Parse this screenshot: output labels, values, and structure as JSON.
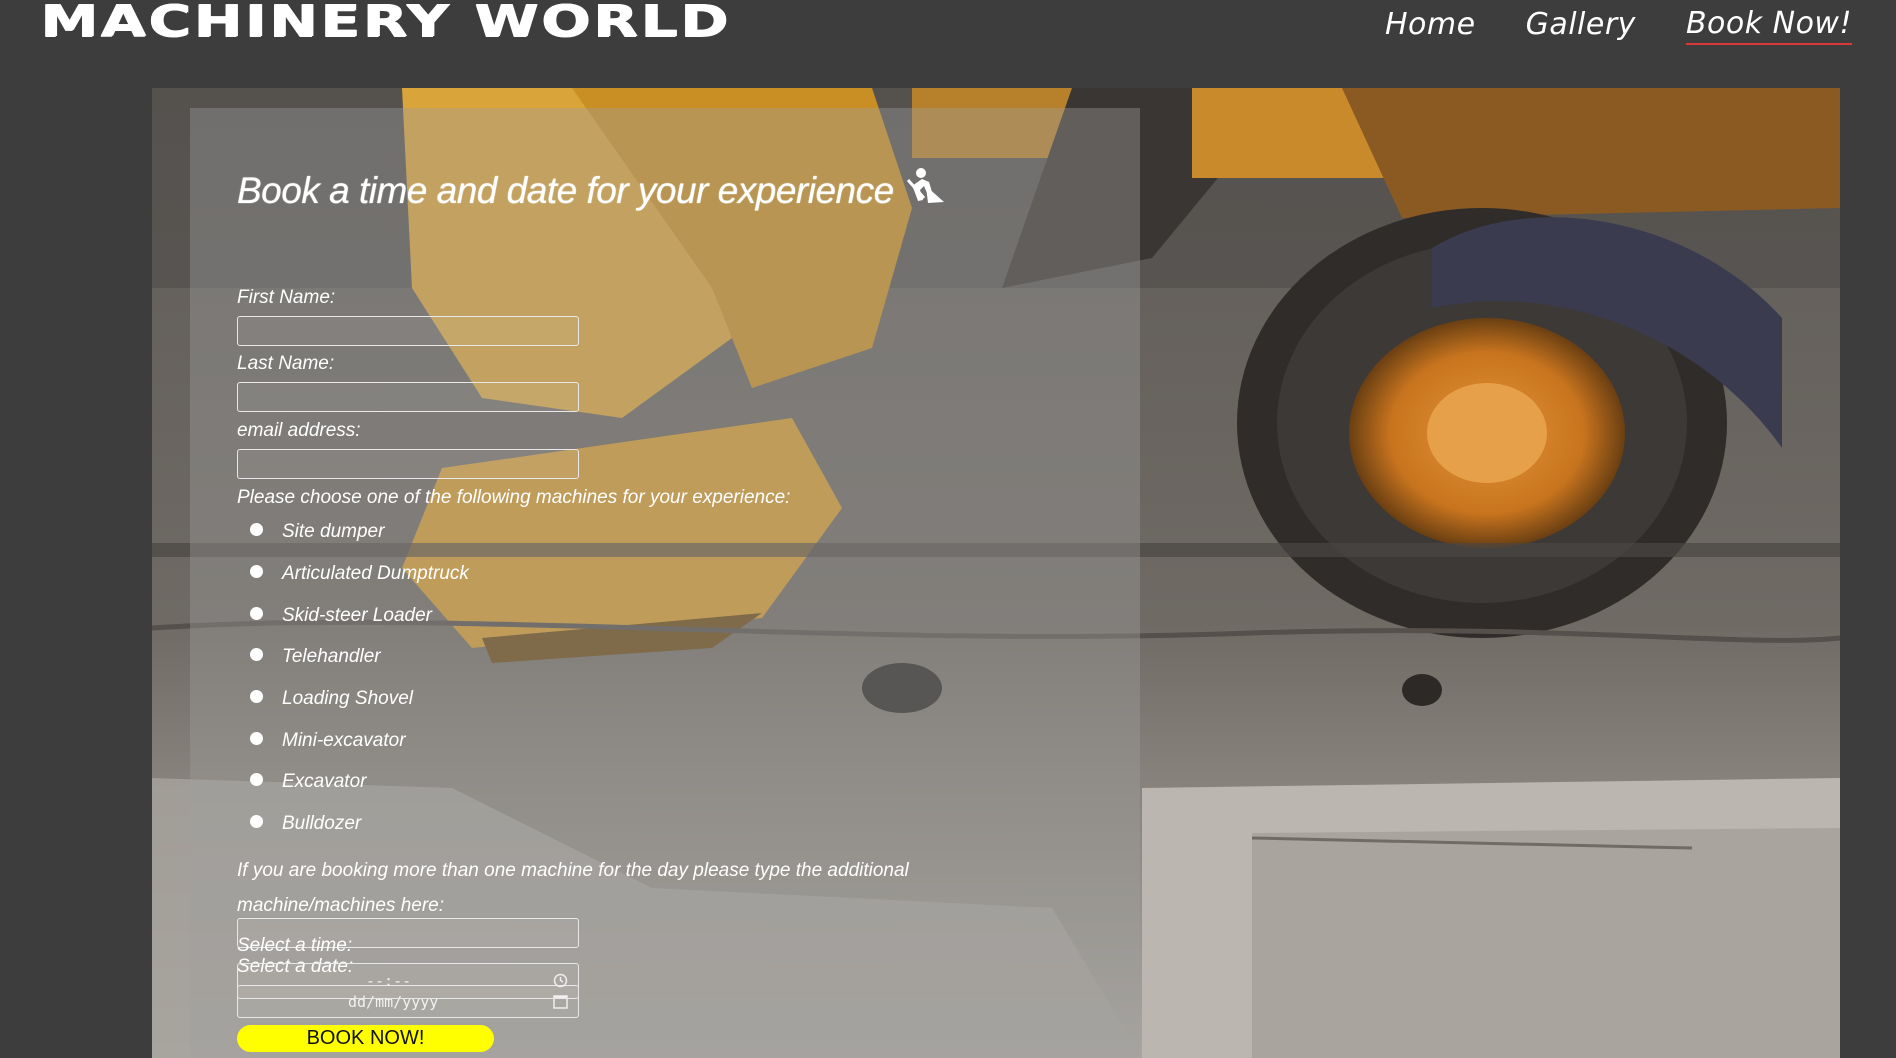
{
  "header": {
    "logo": "MACHINERY WORLD",
    "nav": [
      {
        "label": "Home",
        "active": false
      },
      {
        "label": "Gallery",
        "active": false
      },
      {
        "label": "Book Now!",
        "active": true
      }
    ]
  },
  "form": {
    "title": "Book a time and date for your experience",
    "title_icon": "construction-worker-icon",
    "first_name_label": "First Name:",
    "first_name_value": "",
    "last_name_label": "Last Name:",
    "last_name_value": "",
    "email_label": "email address:",
    "email_value": "",
    "machines_prompt": "Please choose one of the following machines for your experience:",
    "machines": [
      "Site dumper",
      "Articulated Dumptruck",
      "Skid-steer Loader",
      "Telehandler",
      "Loading Shovel",
      "Mini-excavator",
      "Excavator",
      "Bulldozer"
    ],
    "additional_label": "If you are booking more than one machine for the day please type the additional machine/machines here:",
    "additional_value": "",
    "date_label": "Select a date:",
    "date_placeholder": "dd/mm/yyyy",
    "date_icon": "calendar-icon",
    "time_label": "Select a time:",
    "time_placeholder": "--:--",
    "time_icon": "clock-icon",
    "submit_label": "BOOK NOW!"
  },
  "colors": {
    "page_bg": "#3d3d3d",
    "nav_active_underline": "#d83a3a",
    "button_bg": "#ffff00"
  }
}
